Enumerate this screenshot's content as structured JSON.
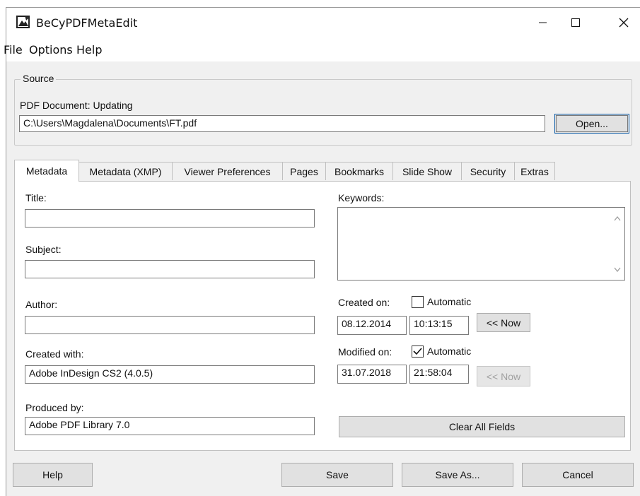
{
  "window": {
    "title": "BeCyPDFMetaEdit"
  },
  "menu": {
    "items": [
      "File",
      "Options",
      "Help"
    ]
  },
  "source": {
    "legend": "Source",
    "status_label": "PDF Document:  Updating",
    "path": "C:\\Users\\Magdalena\\Documents\\FT.pdf",
    "open_label": "Open..."
  },
  "tabs": [
    "Metadata",
    "Metadata (XMP)",
    "Viewer Preferences",
    "Pages",
    "Bookmarks",
    "Slide Show",
    "Security",
    "Extras"
  ],
  "metadata": {
    "title_label": "Title:",
    "title_value": "",
    "subject_label": "Subject:",
    "subject_value": "",
    "author_label": "Author:",
    "author_value": "",
    "created_with_label": "Created with:",
    "created_with_value": "Adobe InDesign CS2 (4.0.5)",
    "produced_by_label": "Produced by:",
    "produced_by_value": "Adobe PDF Library 7.0",
    "keywords_label": "Keywords:",
    "created_on_label": "Created on:",
    "created_automatic_label": "Automatic",
    "created_automatic_checked": false,
    "created_date": "08.12.2014",
    "created_time": "10:13:15",
    "created_now_label": "<< Now",
    "modified_on_label": "Modified on:",
    "modified_automatic_label": "Automatic",
    "modified_automatic_checked": true,
    "modified_date": "31.07.2018",
    "modified_time": "21:58:04",
    "modified_now_label": "<< Now",
    "clear_all_label": "Clear All Fields"
  },
  "footer": {
    "help_label": "Help",
    "save_label": "Save",
    "save_as_label": "Save As...",
    "cancel_label": "Cancel"
  }
}
